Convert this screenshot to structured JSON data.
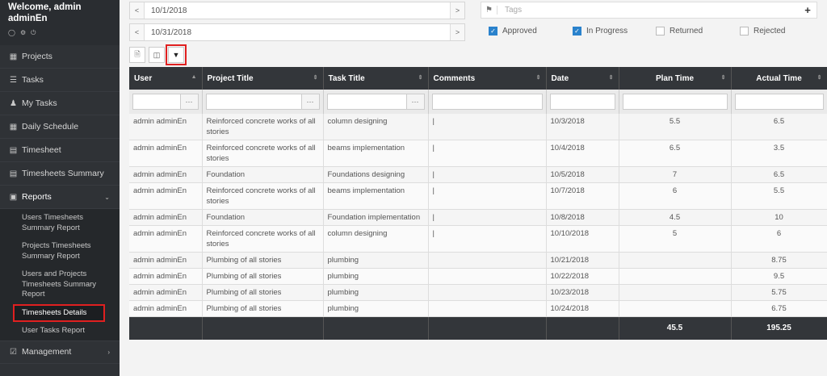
{
  "sidebar": {
    "welcome": "Welcome, admin adminEn",
    "items": [
      {
        "label": "Projects",
        "icon": "projects-icon"
      },
      {
        "label": "Tasks",
        "icon": "tasks-icon"
      },
      {
        "label": "My Tasks",
        "icon": "user-icon"
      },
      {
        "label": "Daily Schedule",
        "icon": "calendar-icon"
      },
      {
        "label": "Timesheet",
        "icon": "timesheet-icon"
      },
      {
        "label": "Timesheets Summary",
        "icon": "summary-icon"
      }
    ],
    "reports": {
      "label": "Reports",
      "sub": [
        "Users Timesheets Summary Report",
        "Projects Timesheets Summary Report",
        "Users and Projects Timesheets Summary Report",
        "Timesheets Details",
        "User Tasks Report"
      ]
    },
    "management": "Management"
  },
  "filters": {
    "from_date": "10/1/2018",
    "to_date": "10/31/2018",
    "tags_placeholder": "Tags",
    "statuses": [
      {
        "label": "Approved",
        "checked": true
      },
      {
        "label": "In Progress",
        "checked": true
      },
      {
        "label": "Returned",
        "checked": false
      },
      {
        "label": "Rejected",
        "checked": false
      }
    ]
  },
  "grid": {
    "headers": [
      "User",
      "Project Title",
      "Task Title",
      "Comments",
      "Date",
      "Plan Time",
      "Actual Time"
    ],
    "rows": [
      [
        "admin adminEn",
        "Reinforced concrete works of all stories",
        "column designing",
        "|",
        "10/3/2018",
        "5.5",
        "6.5"
      ],
      [
        "admin adminEn",
        "Reinforced concrete works of all stories",
        "beams implementation",
        "|",
        "10/4/2018",
        "6.5",
        "3.5"
      ],
      [
        "admin adminEn",
        "Foundation",
        "Foundations designing",
        "|",
        "10/5/2018",
        "7",
        "6.5"
      ],
      [
        "admin adminEn",
        "Reinforced concrete works of all stories",
        "beams implementation",
        "|",
        "10/7/2018",
        "6",
        "5.5"
      ],
      [
        "admin adminEn",
        "Foundation",
        "Foundation implementation",
        "|",
        "10/8/2018",
        "4.5",
        "10"
      ],
      [
        "admin adminEn",
        "Reinforced concrete works of all stories",
        "column designing",
        "|",
        "10/10/2018",
        "5",
        "6"
      ],
      [
        "admin adminEn",
        "Plumbing of all stories",
        "plumbing",
        "",
        "10/21/2018",
        "",
        "8.75"
      ],
      [
        "admin adminEn",
        "Plumbing of all stories",
        "plumbing",
        "",
        "10/22/2018",
        "",
        "9.5"
      ],
      [
        "admin adminEn",
        "Plumbing of all stories",
        "plumbing",
        "",
        "10/23/2018",
        "",
        "5.75"
      ],
      [
        "admin adminEn",
        "Plumbing of all stories",
        "plumbing",
        "",
        "10/24/2018",
        "",
        "6.75"
      ]
    ],
    "totals": {
      "plan": "45.5",
      "actual": "195.25"
    }
  }
}
